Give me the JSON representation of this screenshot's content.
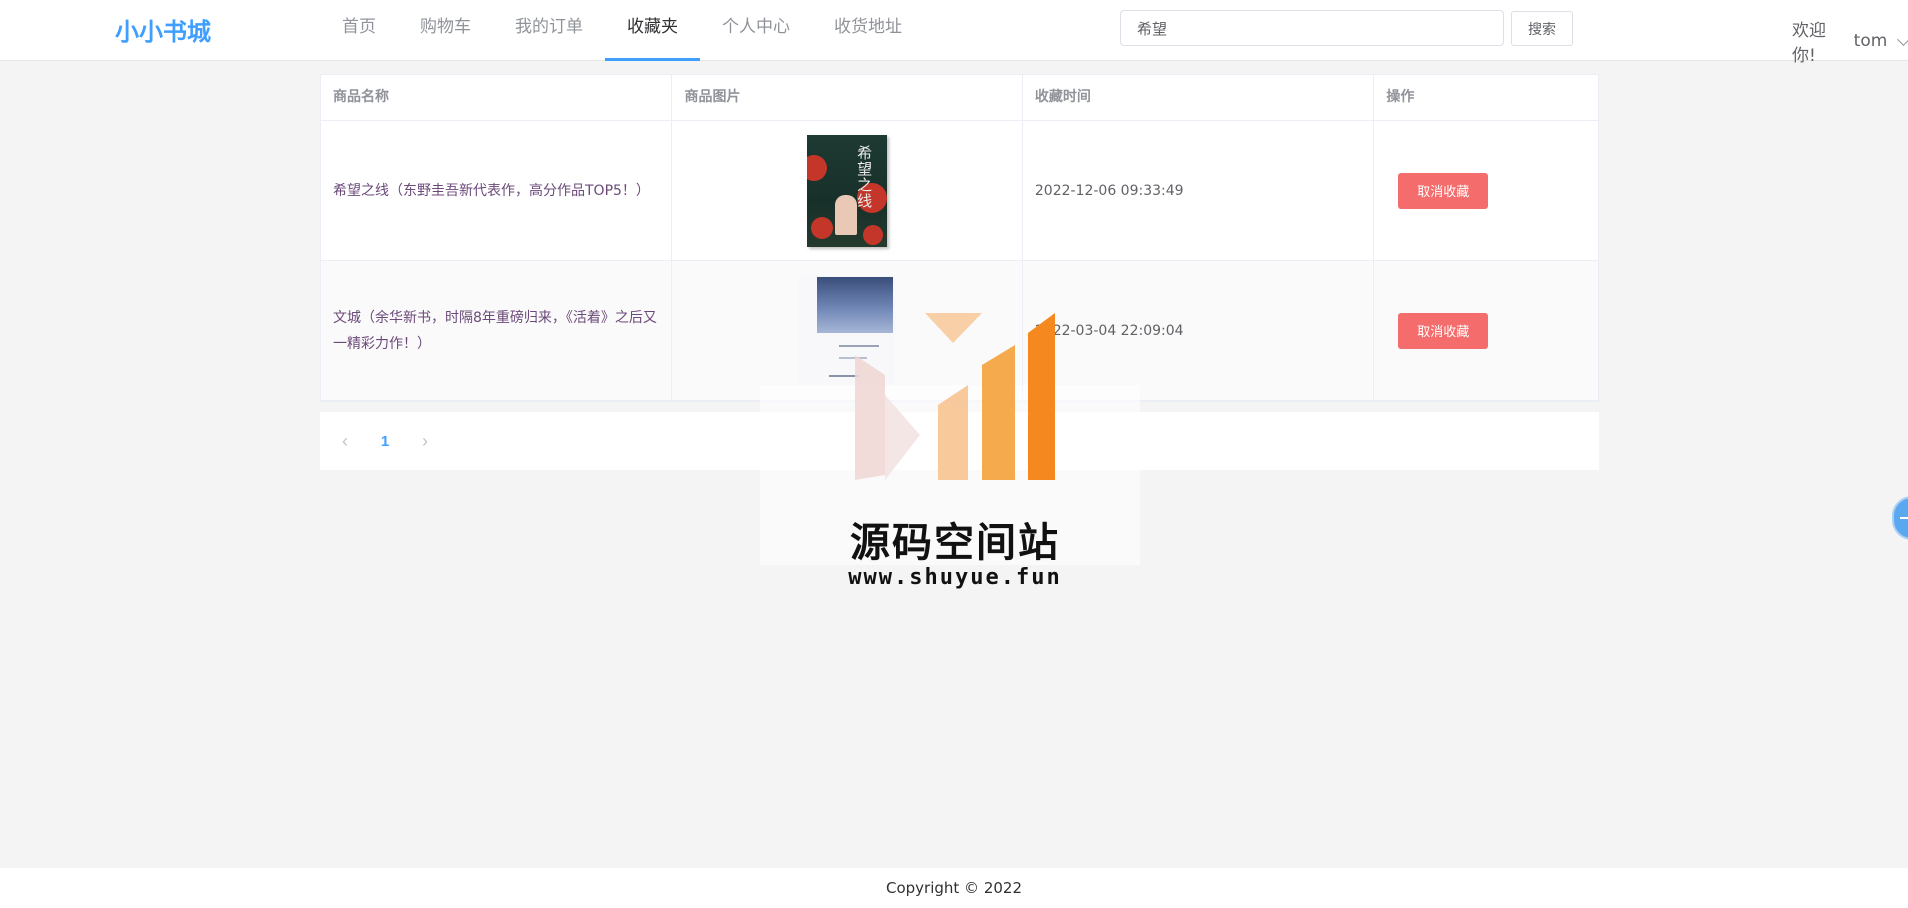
{
  "header": {
    "logo": "小小书城",
    "nav": [
      {
        "label": "首页"
      },
      {
        "label": "购物车"
      },
      {
        "label": "我的订单"
      },
      {
        "label": "收藏夹",
        "active": true
      },
      {
        "label": "个人中心"
      },
      {
        "label": "收货地址"
      }
    ],
    "search": {
      "value": "希望",
      "button_label": "搜索"
    },
    "user": {
      "greeting": "欢迎你!",
      "name": "tom"
    }
  },
  "table": {
    "columns": [
      "商品名称",
      "商品图片",
      "收藏时间",
      "操作"
    ],
    "rows": [
      {
        "name": "希望之线（东野圭吾新代表作，高分作品TOP5！）",
        "cover_text": "希望之线",
        "time": "2022-12-06 09:33:49",
        "action": "取消收藏"
      },
      {
        "name": "文城（余华新书，时隔8年重磅归来，《活着》之后又一精彩力作！）",
        "time": "2022-03-04 22:09:04",
        "action": "取消收藏"
      }
    ]
  },
  "pagination": {
    "current": "1",
    "prev_icon": "chevron-left-icon",
    "next_icon": "chevron-right-icon"
  },
  "watermark": {
    "title": "源码空间站",
    "url": "www.shuyue.fun"
  },
  "footer": {
    "copyright": "Copyright © 2022"
  },
  "colors": {
    "primary": "#409eff",
    "danger": "#f56c6c",
    "watermark_orange": "#f5891f"
  }
}
